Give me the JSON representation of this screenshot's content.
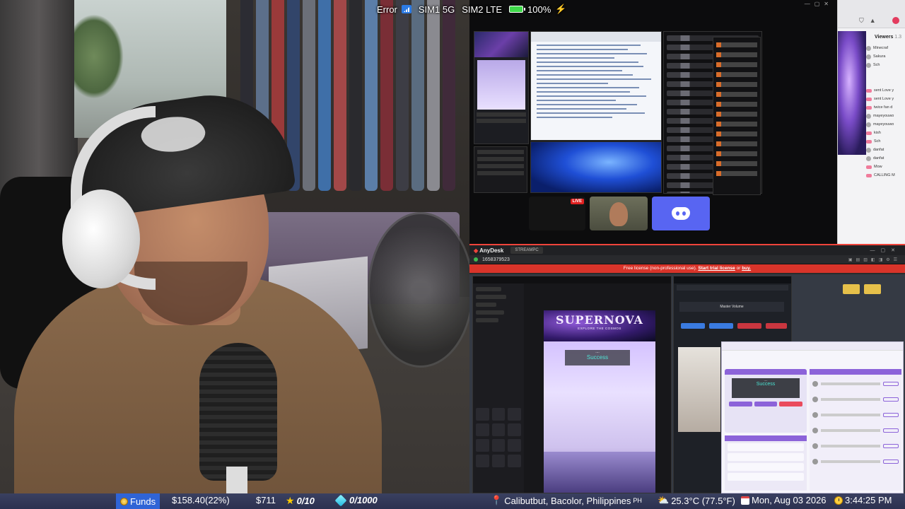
{
  "status_overlay": {
    "error_label": "Error",
    "sim1": "SIM1 5G",
    "sim2": "SIM2 LTE",
    "battery": "100%"
  },
  "capture_windows": {
    "anydesk_title": "AnyDesk",
    "anydesk_tab": "STREAMPC",
    "anydesk_id": "1658379523",
    "license_notice_prefix": "Free license (non-professional use).",
    "license_notice_link": "Start trial license",
    "license_notice_mid": "or",
    "license_notice_buy": "buy.",
    "stream_banner_title": "SUPERNOVA",
    "stream_banner_sub": "EXPLORE THE COSMOS",
    "stream_status": "Success",
    "master_volume_label": "Master Volume",
    "live_badge": "LIVE",
    "viewers_heading": "Viewers",
    "viewers_count": "1.3",
    "viewer_names": [
      "Minecraf",
      "Sakura",
      "Sch",
      "sent Love y",
      "sent Love y",
      "twice fan d",
      "mayeyouwo",
      "mayeyouwo",
      "kish",
      "Sch",
      "danfat",
      "danfat",
      "Mow",
      "CALLING M"
    ]
  },
  "bottom_bar": {
    "funds_label": "Funds",
    "balance": "$158.40(22%)",
    "amount": "$711",
    "star_count": "0/10",
    "gem_count": "0/1000",
    "location": "Calibutbut, Bacolor, Philippines",
    "location_country": "PH",
    "weather": "25.3°C (77.5°F)",
    "date": "Mon, Aug 03 2026",
    "time": "3:44:25 PM"
  },
  "colors": {
    "funds_bg": "#2f64d6",
    "bar_bg": "#333a58",
    "anydesk_red": "#ef443b",
    "status_teal": "#4fe3d6"
  }
}
